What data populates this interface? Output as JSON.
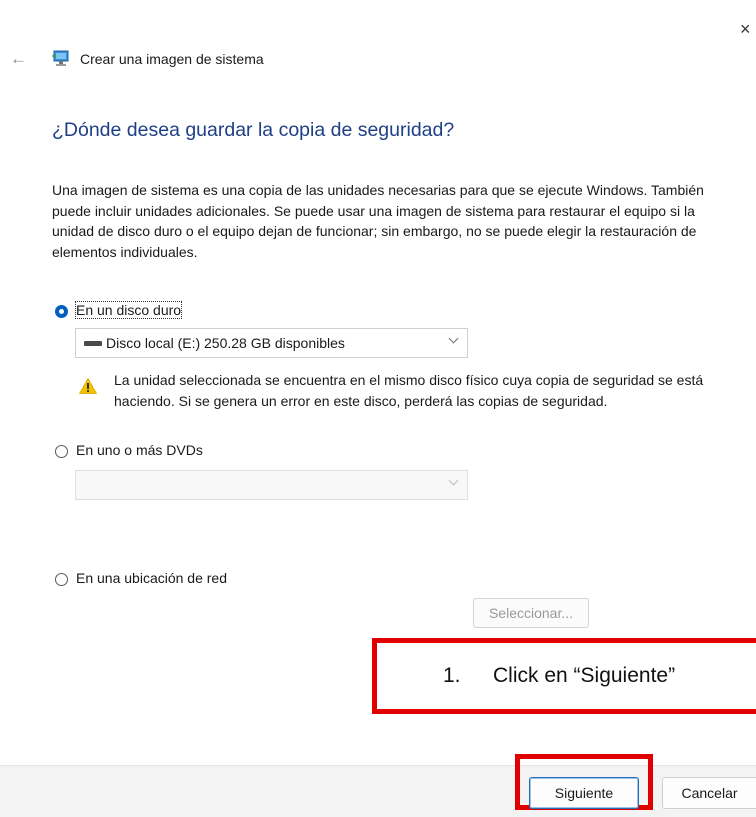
{
  "window": {
    "close_glyph": "×",
    "back_glyph": "←",
    "title": "Crear una imagen de sistema"
  },
  "page": {
    "heading": "¿Dónde desea guardar la copia de seguridad?",
    "description": "Una imagen de sistema es una copia de las unidades necesarias para que se ejecute Windows. También puede incluir unidades adicionales. Se puede usar una imagen de sistema para restaurar el equipo si la unidad de disco duro o el equipo dejan de funcionar; sin embargo, no se puede elegir la restauración de elementos individuales."
  },
  "options": {
    "hard_disk": {
      "label": "En un disco duro",
      "selected": true,
      "drive_value": "Disco local (E:)  250.28 GB disponibles",
      "warning": "La unidad seleccionada se encuentra en el mismo disco físico cuya copia de seguridad se está haciendo. Si se genera un error en este disco, perderá las copias de seguridad."
    },
    "dvd": {
      "label": "En uno o más DVDs",
      "selected": false,
      "drive_value": ""
    },
    "network": {
      "label": "En una ubicación de red",
      "selected": false,
      "select_button": "Seleccionar..."
    }
  },
  "annotation": {
    "number": "1.",
    "text": "Click en “Siguiente”"
  },
  "footer": {
    "next_label": "Siguiente",
    "cancel_label": "Cancelar"
  },
  "colors": {
    "heading": "#1f3f86",
    "radio_selected": "#0060c0",
    "highlight": "#e00000",
    "warning": "#f2c200"
  },
  "icons": {
    "app": "backup-restore-icon",
    "drive": "hard-drive-icon",
    "warning": "warning-triangle-icon"
  }
}
